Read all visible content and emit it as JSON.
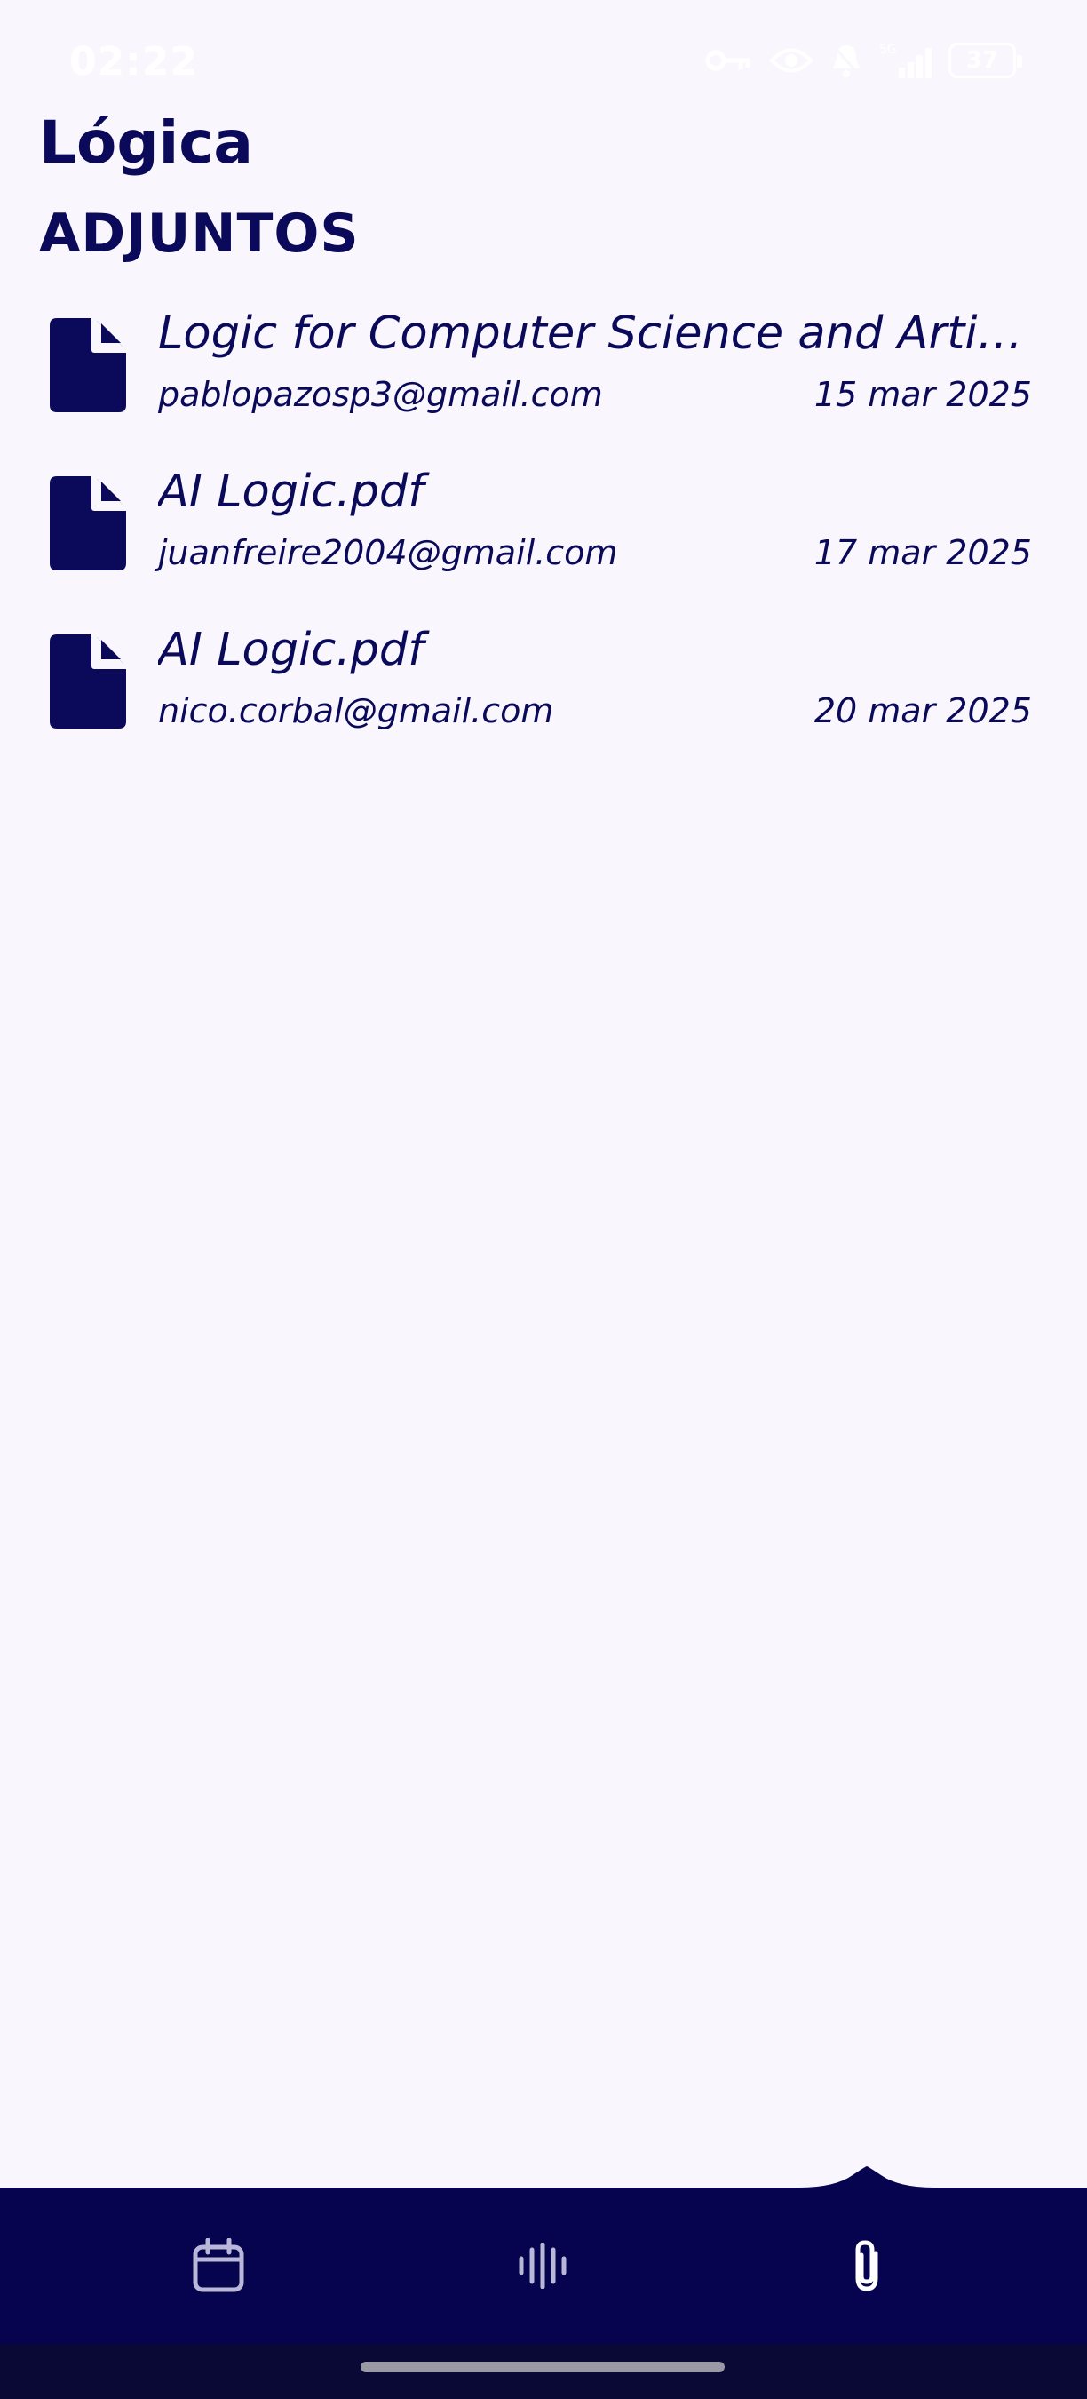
{
  "status_bar": {
    "time": "02:22",
    "battery": "37"
  },
  "header": {
    "title": "Lógica",
    "section": "ADJUNTOS"
  },
  "attachments": [
    {
      "name": "Logic for Computer Science and Artificial Intelligence.pdf",
      "sender": "pablopazosp3@gmail.com",
      "date": "15 mar 2025"
    },
    {
      "name": "AI Logic.pdf",
      "sender": "juanfreire2004@gmail.com",
      "date": "17 mar 2025"
    },
    {
      "name": "AI Logic.pdf",
      "sender": "nico.corbal@gmail.com",
      "date": "20 mar 2025"
    }
  ],
  "bottom_nav": {
    "items": [
      {
        "icon": "calendar-icon"
      },
      {
        "icon": "audio-waveform-icon"
      },
      {
        "icon": "paperclip-icon",
        "active": true
      }
    ]
  },
  "colors": {
    "primary": "#0b0a5a",
    "nav_bg": "#06044f",
    "background": "#f9f7fd"
  }
}
